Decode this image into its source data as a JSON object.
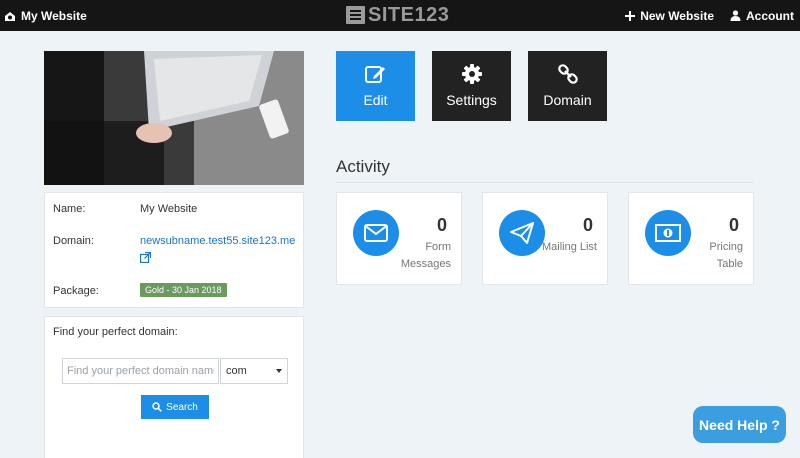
{
  "topbar": {
    "site_name": "My Website",
    "logo_text": "SITE123",
    "new_website": "New Website",
    "account": "Account"
  },
  "info": {
    "name_label": "Name:",
    "name_value": "My Website",
    "domain_label": "Domain:",
    "domain_value": "newsubname.test55.site123.me",
    "package_label": "Package:",
    "package_value": "Gold - 30 Jan 2018"
  },
  "finder": {
    "title": "Find your perfect domain:",
    "placeholder": "Find your perfect domain name",
    "tld": "com",
    "search_label": "Search"
  },
  "actions": {
    "edit": "Edit",
    "settings": "Settings",
    "domain": "Domain"
  },
  "activity": {
    "title": "Activity",
    "cards": [
      {
        "count": "0",
        "label": "Form Messages",
        "icon": "envelope-icon"
      },
      {
        "count": "0",
        "label": "Mailing List",
        "icon": "paper-plane-icon"
      },
      {
        "count": "0",
        "label": "Pricing Table",
        "icon": "money-icon"
      }
    ]
  },
  "help": "Need Help ?",
  "colors": {
    "accent": "#1c8ee8",
    "dark": "#222222",
    "badge": "#6b9a5f"
  }
}
